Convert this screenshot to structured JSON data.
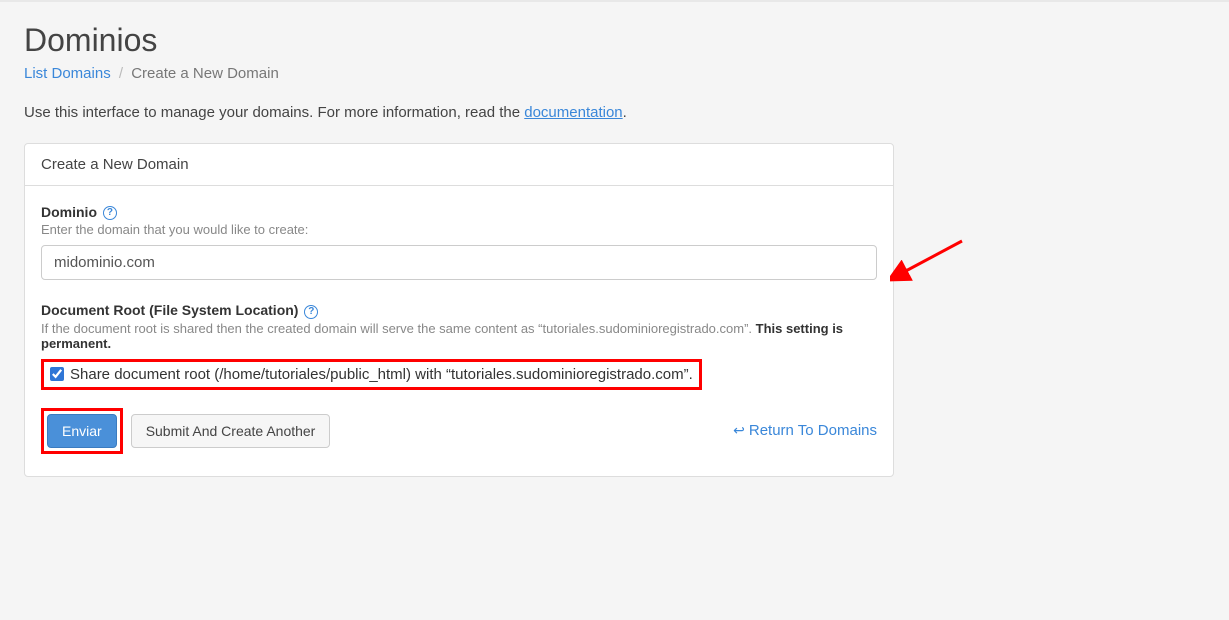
{
  "header": {
    "title": "Dominios"
  },
  "breadcrumb": {
    "list_domains": "List Domains",
    "sep": "/",
    "current": "Create a New Domain"
  },
  "intro": {
    "prefix": "Use this interface to manage your domains. For more information, read the ",
    "link_text": "documentation",
    "suffix": "."
  },
  "panel": {
    "heading": "Create a New Domain"
  },
  "domain_field": {
    "label": "Dominio",
    "desc": "Enter the domain that you would like to create:",
    "value": "midominio.com"
  },
  "docroot_field": {
    "label": "Document Root (File System Location)",
    "desc_prefix": "If the document root is shared then the created domain will serve the same content as “tutoriales.sudominioregistrado.com”. ",
    "desc_bold": "This setting is permanent.",
    "checkbox_label": "Share document root (/home/tutoriales/public_html) with “tutoriales.sudominioregistrado.com”."
  },
  "buttons": {
    "submit": "Enviar",
    "submit_another": "Submit And Create Another",
    "return": "Return To Domains"
  }
}
